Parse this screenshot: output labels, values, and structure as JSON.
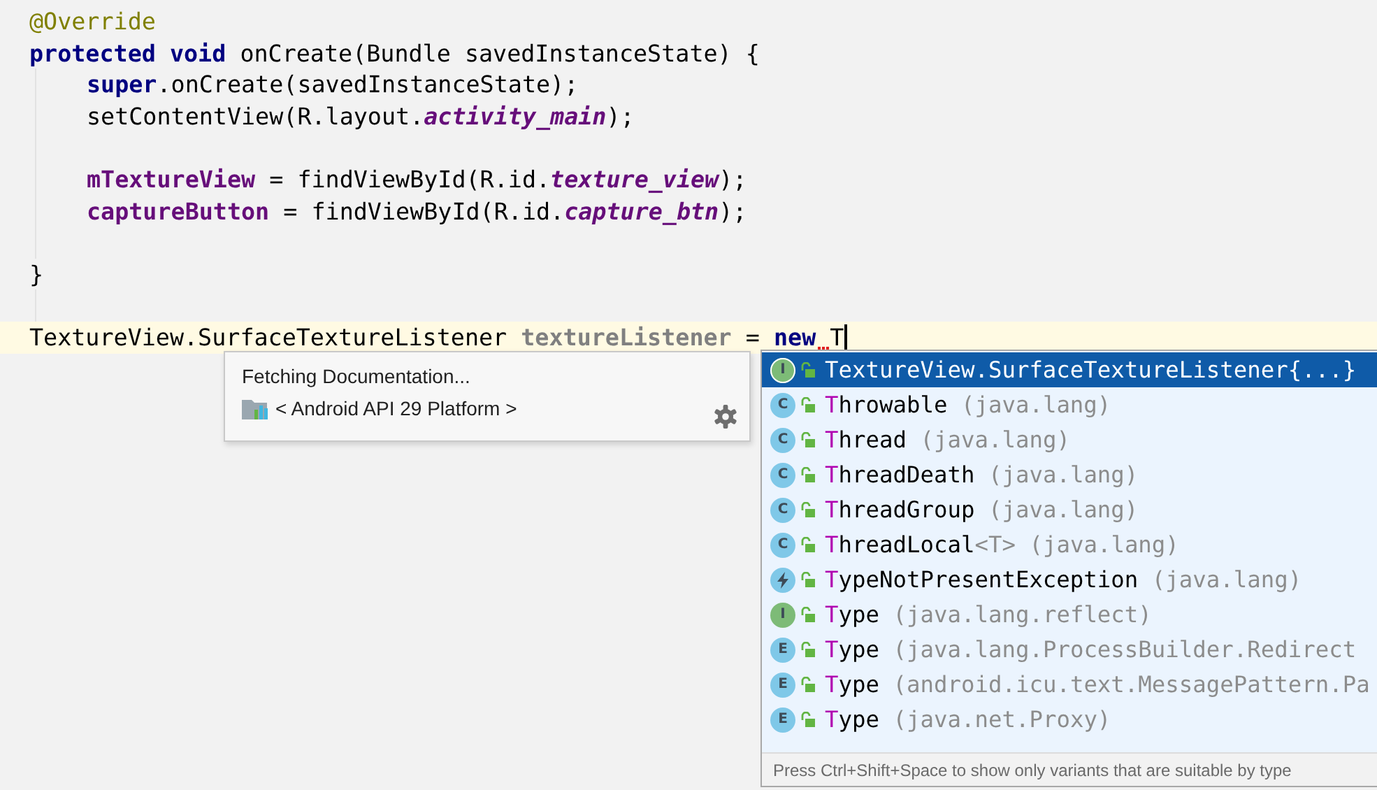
{
  "editor": {
    "lines": [
      {
        "kind": "code",
        "indented": false,
        "current": false,
        "tokens": [
          {
            "text": "@Override",
            "kind": "annotation"
          }
        ]
      },
      {
        "kind": "code",
        "indented": false,
        "current": false,
        "tokens": [
          {
            "text": "protected ",
            "kind": "keyword"
          },
          {
            "text": "void",
            "kind": "keyword"
          },
          {
            "text": " onCreate(Bundle savedInstanceState) {",
            "kind": "plain"
          }
        ]
      },
      {
        "kind": "code",
        "indented": true,
        "current": false,
        "tokens": [
          {
            "text": "super",
            "kind": "keyword"
          },
          {
            "text": ".onCreate(savedInstanceState);",
            "kind": "plain"
          }
        ]
      },
      {
        "kind": "code",
        "indented": true,
        "current": false,
        "tokens": [
          {
            "text": "setContentView(R.layout.",
            "kind": "plain"
          },
          {
            "text": "activity_main",
            "kind": "static"
          },
          {
            "text": ");",
            "kind": "plain"
          }
        ]
      },
      {
        "kind": "blank"
      },
      {
        "kind": "code",
        "indented": true,
        "current": false,
        "tokens": [
          {
            "text": "mTextureView",
            "kind": "field"
          },
          {
            "text": " = findViewById(R.id.",
            "kind": "plain"
          },
          {
            "text": "texture_view",
            "kind": "static"
          },
          {
            "text": ");",
            "kind": "plain"
          }
        ]
      },
      {
        "kind": "code",
        "indented": true,
        "current": false,
        "tokens": [
          {
            "text": "captureButton",
            "kind": "field"
          },
          {
            "text": " = findViewById(R.id.",
            "kind": "plain"
          },
          {
            "text": "capture_btn",
            "kind": "static"
          },
          {
            "text": ");",
            "kind": "plain"
          }
        ]
      },
      {
        "kind": "blank"
      },
      {
        "kind": "code",
        "indented": false,
        "current": false,
        "tokens": [
          {
            "text": "}",
            "kind": "plain"
          }
        ]
      },
      {
        "kind": "blank"
      },
      {
        "kind": "code",
        "indented": false,
        "current": true,
        "tokens": [
          {
            "text": "TextureView.SurfaceTextureListener ",
            "kind": "plain"
          },
          {
            "text": "textureListener",
            "kind": "unused"
          },
          {
            "text": " = ",
            "kind": "plain"
          },
          {
            "text": "new",
            "kind": "keyword"
          },
          {
            "text": " T",
            "kind": "plain",
            "error": true
          }
        ]
      }
    ]
  },
  "documentation_popup": {
    "status": "Fetching Documentation...",
    "library": "< Android API 29 Platform >"
  },
  "completion": {
    "items": [
      {
        "kind": "interface",
        "letter": "I",
        "match": "T",
        "name": "extureView.SurfaceTextureListener{...}",
        "selected": true
      },
      {
        "kind": "class",
        "letter": "C",
        "match": "T",
        "name": "hrowable",
        "package": "(java.lang)",
        "selected": false
      },
      {
        "kind": "class",
        "letter": "C",
        "match": "T",
        "name": "hread",
        "package": "(java.lang)",
        "selected": false
      },
      {
        "kind": "class",
        "letter": "C",
        "match": "T",
        "name": "hreadDeath",
        "package": "(java.lang)",
        "selected": false
      },
      {
        "kind": "class",
        "letter": "C",
        "match": "T",
        "name": "hreadGroup",
        "package": "(java.lang)",
        "selected": false
      },
      {
        "kind": "class",
        "letter": "C",
        "match": "T",
        "name": "hreadLocal",
        "type_params": "<T>",
        "package": "(java.lang)",
        "selected": false
      },
      {
        "kind": "exception",
        "match": "T",
        "name": "ypeNotPresentException",
        "package": "(java.lang)",
        "selected": false
      },
      {
        "kind": "interface",
        "letter": "I",
        "match": "T",
        "name": "ype",
        "package": "(java.lang.reflect)",
        "selected": false
      },
      {
        "kind": "enum",
        "letter": "E",
        "match": "T",
        "name": "ype",
        "package": "(java.lang.ProcessBuilder.Redirect",
        "selected": false
      },
      {
        "kind": "enum",
        "letter": "E",
        "match": "T",
        "name": "ype",
        "package": "(android.icu.text.MessagePattern.Pa",
        "selected": false
      },
      {
        "kind": "enum",
        "letter": "E",
        "match": "T",
        "name": "ype",
        "package": "(java.net.Proxy)",
        "selected": false
      }
    ],
    "hint": "Press Ctrl+Shift+Space to show only variants that are suitable by type"
  }
}
